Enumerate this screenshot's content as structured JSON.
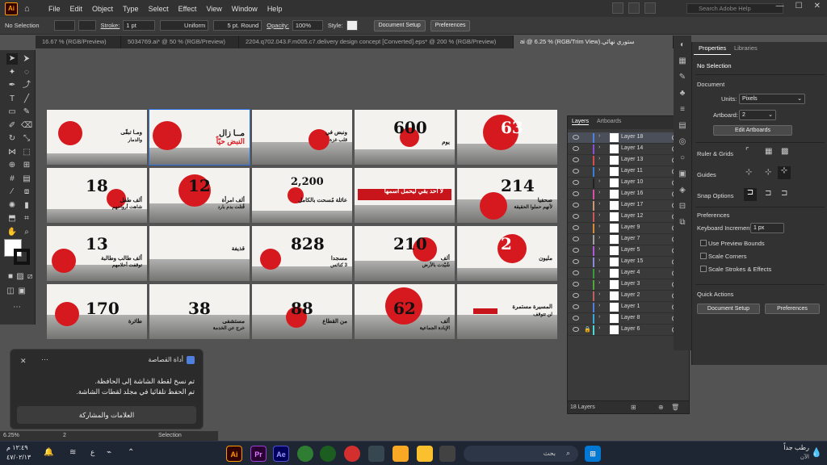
{
  "app": {
    "logo": "Ai",
    "colors": {
      "accent": "#ff9a00",
      "red": "#d6191f"
    }
  },
  "menu": [
    "File",
    "Edit",
    "Object",
    "Type",
    "Select",
    "Effect",
    "View",
    "Window",
    "Help"
  ],
  "search": {
    "placeholder": "Search Adobe Help"
  },
  "control": {
    "selection": "No Selection",
    "stroke_label": "Stroke:",
    "stroke_value": "1 pt",
    "profile": "Uniform",
    "brush": "5 pt. Round",
    "opacity_label": "Opacity:",
    "opacity_value": "100%",
    "style_label": "Style:",
    "doc_setup": "Document Setup",
    "preferences": "Preferences"
  },
  "tabs": [
    "16.67 % (RGB/Preview)",
    "5034769.ai* @ 50 % (RGB/Preview)",
    "2204.q702.043.F.m005.c7.delivery design concept [Converted].eps* @ 200 % (RGB/Preview)",
    "ستوري نهائي.ai @ 6.25 % (RGB/Trim View)"
  ],
  "artboards": [
    {
      "t1": "ومـا تبقّى",
      "t2": "والدمار"
    },
    {
      "t1": "مــا زال",
      "t2": "النبض حيّاً"
    },
    {
      "t1": "ونبض في",
      "t2": "قلب غزة"
    },
    {
      "num": "600",
      "t1": "يوم"
    },
    {
      "num": "63",
      "t1": ""
    },
    {
      "num": "18",
      "t1": "ألف طفل",
      "t2": "شاهت أرواحهم"
    },
    {
      "num": "12",
      "t1": "ألف امرأة",
      "t2": "قُتلت بدم بارد"
    },
    {
      "num": "2,200",
      "t1": "عائلة مُسحت بالكامل"
    },
    {
      "t1": "لا أحد بقي ليحمل اسمها"
    },
    {
      "num": "214",
      "t1": "صحفيا",
      "t2": "لأنهم حملوا الحقيقة"
    },
    {
      "num": "13",
      "t1": "ألف طالب وطالبة",
      "t2": "توقفت أحلامهم"
    },
    {
      "t1": "قذيفة"
    },
    {
      "num": "828",
      "t1": "مسجدا",
      "t2": "3 كنائس"
    },
    {
      "num": "210",
      "t1": "ألف",
      "t2": "شُيّدت بالأرض"
    },
    {
      "num": "2",
      "t1": "مليون"
    },
    {
      "num": "170",
      "t1": "طائرة"
    },
    {
      "num": "38",
      "t1": "مستشفى",
      "t2": "خرج عن الخدمة"
    },
    {
      "num": "88",
      "t1": "من القطاع"
    },
    {
      "num": "62",
      "t1": "ألف",
      "t2": "الإبادة الجماعية"
    },
    {
      "t1": "المسيرة مستمرة",
      "t2": "لن تتوقف"
    }
  ],
  "layers_panel": {
    "tab_layers": "Layers",
    "tab_artboards": "Artboards",
    "footer": "18 Layers",
    "rows": [
      {
        "name": "Layer 18",
        "color": "#4f7fdf"
      },
      {
        "name": "Layer 14",
        "color": "#8a4fd6"
      },
      {
        "name": "Layer 13",
        "color": "#d64f4f"
      },
      {
        "name": "Layer 11",
        "color": "#3a7fd6"
      },
      {
        "name": "Layer 10",
        "color": "#222"
      },
      {
        "name": "Layer 16",
        "color": "#d64fa8"
      },
      {
        "name": "Layer 17",
        "color": "#c99a7a"
      },
      {
        "name": "Layer 12",
        "color": "#c95a5a"
      },
      {
        "name": "Layer 9",
        "color": "#d68a3a"
      },
      {
        "name": "Layer 7",
        "color": "#a0a0a0"
      },
      {
        "name": "Layer 5",
        "color": "#b05ad6"
      },
      {
        "name": "Layer 15",
        "color": "#8a8ad6"
      },
      {
        "name": "Layer 4",
        "color": "#3a9a3a"
      },
      {
        "name": "Layer 3",
        "color": "#4fa83a"
      },
      {
        "name": "Layer 2",
        "color": "#c06060"
      },
      {
        "name": "Layer 1",
        "color": "#4f7fdf"
      },
      {
        "name": "Layer 8",
        "color": "#3aa8d6"
      },
      {
        "name": "Layer 6",
        "color": "#4fd6d6"
      }
    ]
  },
  "properties": {
    "tab_properties": "Properties",
    "tab_libraries": "Libraries",
    "no_selection": "No Selection",
    "document": "Document",
    "units_label": "Units:",
    "units_value": "Pixels",
    "artboard_label": "Artboard:",
    "artboard_value": "2",
    "edit_artboards": "Edit Artboards",
    "ruler_grids": "Ruler & Grids",
    "guides": "Guides",
    "snap_options": "Snap Options",
    "preferences": "Preferences",
    "keyboard_inc_label": "Keyboard Increment:",
    "keyboard_inc_value": "1 px",
    "use_preview_bounds": "Use Preview Bounds",
    "scale_corners": "Scale Corners",
    "scale_strokes": "Scale Strokes & Effects",
    "quick_actions": "Quick Actions",
    "doc_setup": "Document Setup",
    "prefs_btn": "Preferences"
  },
  "toast": {
    "title": "أداة القصاصة",
    "line1": "تم نسخ لقطة الشاشة إلى الحافظة.",
    "line2": "تم الحفظ تلقائيا في مجلد لقطات الشاشة.",
    "action": "العلامات والمشاركة"
  },
  "status": {
    "zoom": "6.25%",
    "page": "2",
    "mode": "Selection"
  },
  "taskbar": {
    "time": "١٢:٤٩ م",
    "date": "٤٧/٠٢/١٣",
    "search": "بحث",
    "weather": "رطب جداً",
    "weather_sub": "الآن",
    "lang": "ع"
  }
}
